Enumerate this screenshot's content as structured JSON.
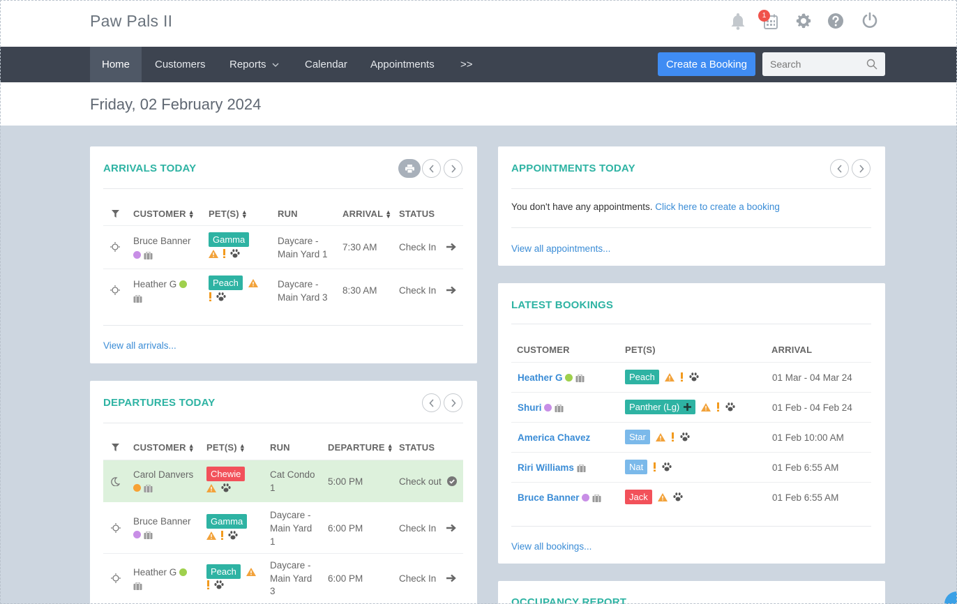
{
  "app": {
    "title": "Paw Pals II",
    "notification_count": "1"
  },
  "nav": {
    "items": [
      "Home",
      "Customers",
      "Reports",
      "Calendar",
      "Appointments",
      ">>"
    ],
    "create_booking": "Create a Booking",
    "search_placeholder": "Search"
  },
  "date": "Friday, 02 February 2024",
  "arrivals": {
    "title": "ARRIVALS TODAY",
    "headers": {
      "customer": "CUSTOMER",
      "pets": "PET(S)",
      "run": "RUN",
      "arrival": "ARRIVAL",
      "status": "STATUS"
    },
    "rows": [
      {
        "customer": "Bruce Banner",
        "pet": "Gamma",
        "run1": "Daycare -",
        "run2": "Main Yard 1",
        "time": "7:30 AM",
        "status": "Check In"
      },
      {
        "customer": "Heather G",
        "pet": "Peach",
        "run1": "Daycare -",
        "run2": "Main Yard 3",
        "time": "8:30 AM",
        "status": "Check In"
      }
    ],
    "view_all": "View all arrivals..."
  },
  "departures": {
    "title": "DEPARTURES TODAY",
    "headers": {
      "customer": "CUSTOMER",
      "pets": "PET(S)",
      "run": "RUN",
      "departure": "DEPARTURE",
      "status": "STATUS"
    },
    "rows": [
      {
        "customer": "Carol Danvers",
        "pet": "Chewie",
        "run1": "Cat Condo",
        "run2": "1",
        "run3": "",
        "time": "5:00 PM",
        "status": "Check out"
      },
      {
        "customer": "Bruce Banner",
        "pet": "Gamma",
        "run1": "Daycare -",
        "run2": "Main Yard",
        "run3": "1",
        "time": "6:00 PM",
        "status": "Check In"
      },
      {
        "customer": "Heather G",
        "pet": "Peach",
        "run1": "Daycare -",
        "run2": "Main Yard",
        "run3": "3",
        "time": "6:00 PM",
        "status": "Check In"
      }
    ]
  },
  "appointments": {
    "title": "APPOINTMENTS TODAY",
    "empty_text": "You don't have any appointments.",
    "create_link": "Click here to create a booking",
    "view_all": "View all appointments..."
  },
  "bookings": {
    "title": "LATEST BOOKINGS",
    "headers": {
      "customer": "CUSTOMER",
      "pets": "PET(S)",
      "arrival": "ARRIVAL"
    },
    "rows": [
      {
        "customer": "Heather G",
        "pet": "Peach",
        "arrival": "01 Mar - 04 Mar 24"
      },
      {
        "customer": "Shuri",
        "pet": "Panther (Lg)",
        "arrival": "01 Feb - 04 Feb 24"
      },
      {
        "customer": "America Chavez",
        "pet": "Star",
        "arrival": "01 Feb 10:00 AM"
      },
      {
        "customer": "Riri Williams",
        "pet": "Nat",
        "arrival": "01 Feb 6:55 AM"
      },
      {
        "customer": "Bruce Banner",
        "pet": "Jack",
        "arrival": "01 Feb 6:55 AM"
      }
    ],
    "view_all": "View all bookings..."
  },
  "occupancy": {
    "title": "OCCUPANCY REPORT"
  },
  "colors": {
    "accent_teal": "#2eb3a3",
    "navbar": "#3d4450",
    "button_blue": "#3f8cf3",
    "tag_red": "#f2515a",
    "tag_blue": "#7bb9ea"
  }
}
